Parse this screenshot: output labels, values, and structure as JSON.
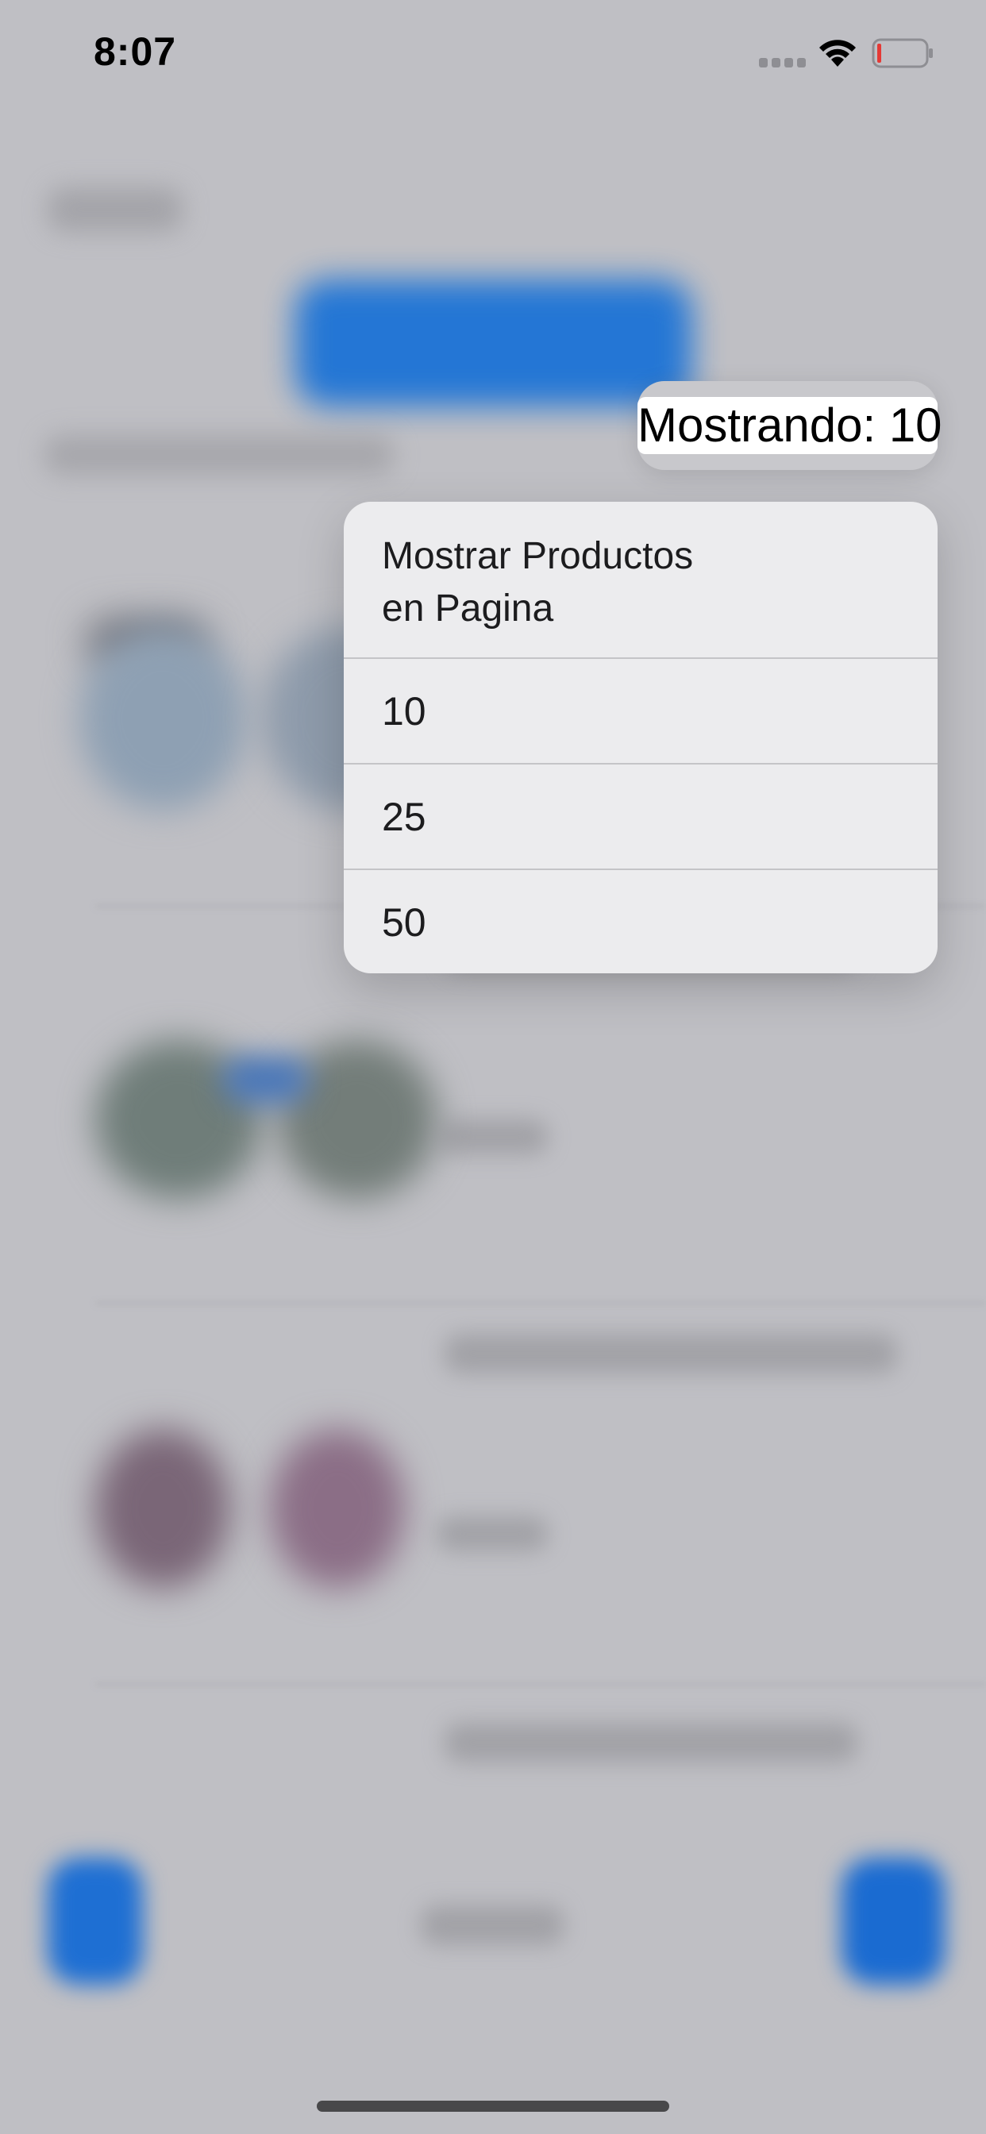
{
  "status_bar": {
    "time": "8:07",
    "icons": [
      "signal-icon",
      "wifi-icon",
      "battery-low-icon"
    ],
    "battery_level": 0.08,
    "battery_color": "#e53935"
  },
  "showing": {
    "label": "Mostrando: 10"
  },
  "menu": {
    "title": "Mostrar Productos\nen Pagina",
    "options": [
      {
        "label": "10"
      },
      {
        "label": "25"
      },
      {
        "label": "50"
      }
    ]
  },
  "colors": {
    "accent": "#1c73d6",
    "menu_bg": "#ececee",
    "overlay_bg": "#bfbfc4"
  }
}
